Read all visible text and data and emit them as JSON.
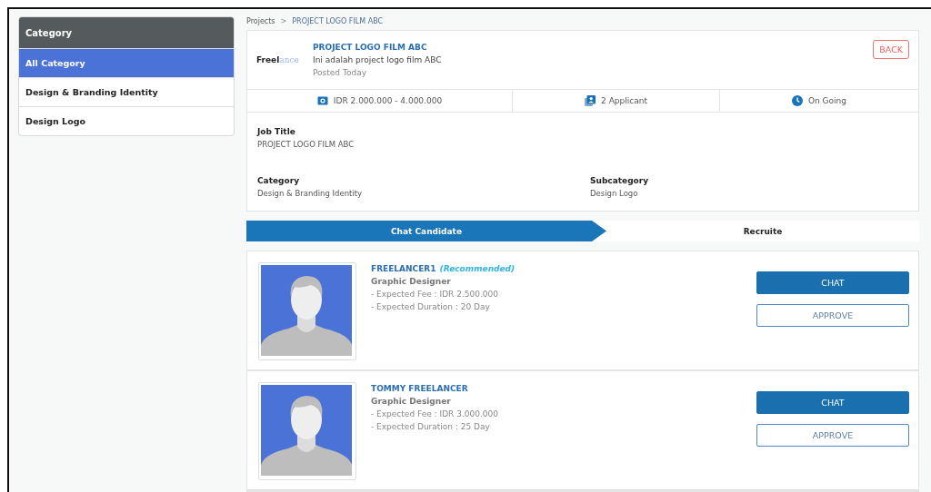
{
  "sidebar": {
    "title": "Category",
    "items": [
      {
        "label": "All Category",
        "selected": true
      },
      {
        "label": "Design & Branding Identity",
        "selected": false
      },
      {
        "label": "Design Logo",
        "selected": false
      }
    ]
  },
  "breadcrumb": {
    "items": [
      "Projects",
      "PROJECT LOGO FILM ABC"
    ],
    "separator": ">"
  },
  "project": {
    "logo": {
      "dark": "Freel",
      "light": "ance"
    },
    "title": "PROJECT LOGO FILM ABC",
    "description": "Ini adalah project logo film ABC",
    "posted": "Posted Today",
    "back": "BACK",
    "stats": [
      {
        "kind": "money",
        "text": "IDR 2.000.000 - 4.000.000"
      },
      {
        "kind": "applicant",
        "text": "2 Applicant"
      },
      {
        "kind": "clock",
        "text": "On Going"
      }
    ],
    "job_title": {
      "label": "Job Title",
      "value": "PROJECT LOGO FILM ABC"
    },
    "fields": [
      {
        "label": "Category",
        "value": "Design & Branding Identity"
      },
      {
        "label": "Subcategory",
        "value": "Design Logo"
      }
    ]
  },
  "steps": [
    {
      "label": "Chat Candidate",
      "selected": true
    },
    {
      "label": "Recruite",
      "selected": false
    }
  ],
  "candidates": [
    {
      "name": "FREELANCER1",
      "tag": "(Recommended)",
      "role": "Graphic Designer",
      "fee": "- Expected Fee : IDR 2.500.000",
      "duration": "- Expected Duration : 20 Day",
      "chat": "CHAT",
      "approve": "APPROVE"
    },
    {
      "name": "TOMMY FREELANCER",
      "role": "Graphic Designer",
      "fee": "- Expected Fee : IDR 3.000.000",
      "duration": "- Expected Duration : 25 Day",
      "chat": "CHAT",
      "approve": "APPROVE"
    }
  ]
}
